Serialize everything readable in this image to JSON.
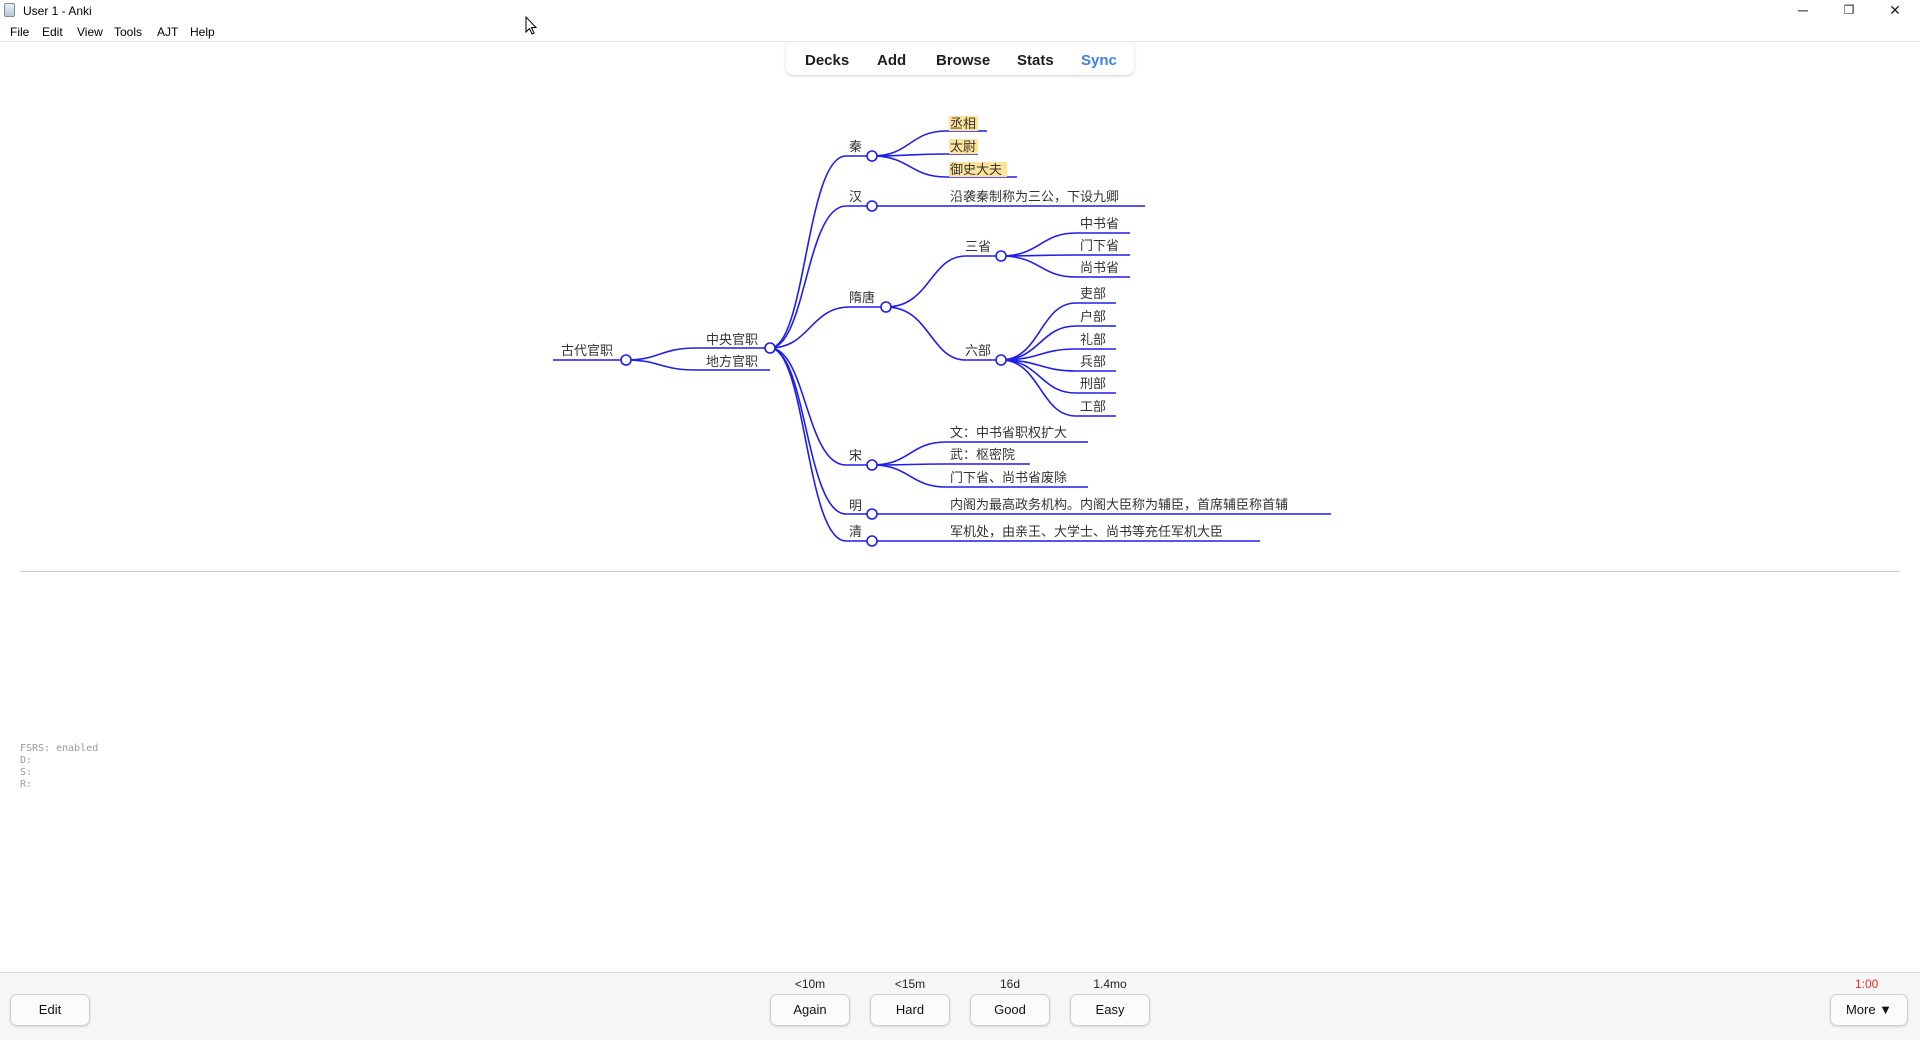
{
  "window": {
    "title": "User 1 - Anki",
    "minimize": "─",
    "restore": "❐",
    "close": "✕"
  },
  "menu": {
    "items": [
      {
        "label": "File"
      },
      {
        "label": "Edit"
      },
      {
        "label": "View"
      },
      {
        "label": "Tools"
      },
      {
        "label": "AJT"
      },
      {
        "label": "Help"
      }
    ]
  },
  "toolbar": {
    "decks": "Decks",
    "add": "Add",
    "browse": "Browse",
    "stats": "Stats",
    "sync": "Sync"
  },
  "mindmap": {
    "root": "古代官职",
    "central": "中央官职",
    "local": "地方官职",
    "qin": {
      "label": "秦",
      "children": [
        "丞相",
        "太尉",
        "御史大夫"
      ]
    },
    "han": {
      "label": "汉",
      "children": [
        "沿袭秦制称为三公，下设九卿"
      ]
    },
    "suitang": {
      "label": "隋唐",
      "sansheng": {
        "label": "三省",
        "children": [
          "中书省",
          "门下省",
          "尚书省"
        ]
      },
      "liubu": {
        "label": "六部",
        "children": [
          "吏部",
          "户部",
          "礼部",
          "兵部",
          "刑部",
          "工部"
        ]
      }
    },
    "song": {
      "label": "宋",
      "children": [
        "文：中书省职权扩大",
        "武：枢密院",
        "门下省、尚书省废除"
      ]
    },
    "ming": {
      "label": "明",
      "children": [
        "内阁为最高政务机构。内阁大臣称为辅臣，首席辅臣称首辅"
      ]
    },
    "qing": {
      "label": "清",
      "children": [
        "军机处，由亲王、大学士、尚书等充任军机大臣"
      ]
    },
    "highlight_color": "#ffe39a",
    "line_color": "#1f1fe6"
  },
  "fsrs": {
    "line1": "FSRS: enabled",
    "line2": "D:",
    "line3": "S:",
    "line4": "R:"
  },
  "bottom": {
    "edit": "Edit",
    "again": {
      "label": "Again",
      "due": "<10m"
    },
    "hard": {
      "label": "Hard",
      "due": "<15m"
    },
    "good": {
      "label": "Good",
      "due": "16d"
    },
    "easy": {
      "label": "Easy",
      "due": "1.4mo"
    },
    "more": "More ▼",
    "timer": "1:00"
  }
}
